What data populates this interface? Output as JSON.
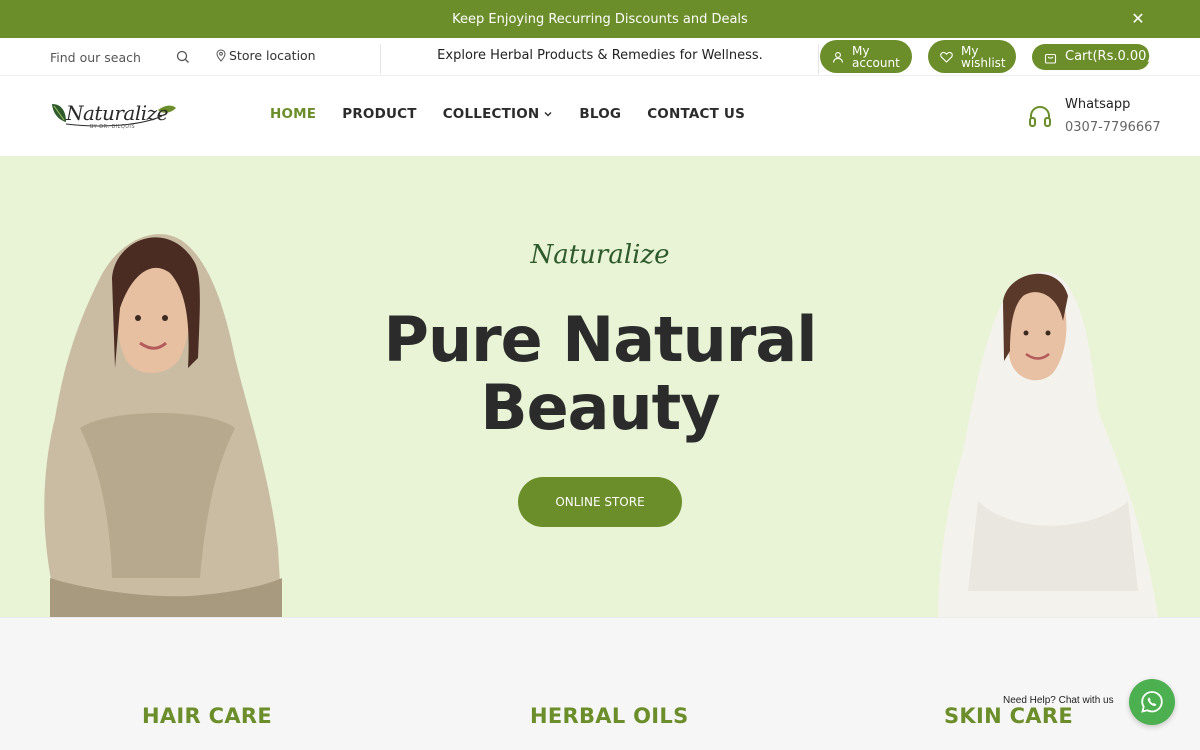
{
  "announcement": {
    "text": "Keep Enjoying Recurring Discounts and Deals",
    "close_icon": "close-icon"
  },
  "utility": {
    "search_placeholder": "Find our seach",
    "store_location": "Store location",
    "tagline": "Explore Herbal Products & Remedies for Wellness.",
    "account_label": "My account",
    "wishlist_label": "My wishlist",
    "cart_label": "Cart(Rs.0.00)"
  },
  "logo": {
    "wordmark": "Naturalize",
    "byline": "BY DR. BILQUIS"
  },
  "nav": {
    "home": "HOME",
    "product": "PRODUCT",
    "collection": "COLLECTION",
    "blog": "BLOG",
    "contact": "CONTACT US"
  },
  "contact": {
    "title": "Whatsapp",
    "phone": "0307-7796667"
  },
  "hero": {
    "script": "Naturalize",
    "headline_line1": "Pure Natural",
    "headline_line2": "Beauty",
    "cta": "ONLINE STORE"
  },
  "categories": [
    "HAIR CARE",
    "HERBAL OILS",
    "SKIN CARE"
  ],
  "whatsapp_widget": {
    "help_text": "Need Help? Chat with us"
  },
  "colors": {
    "brand_green": "#6b8e2a",
    "hero_bg": "#e9f4d6",
    "whatsapp": "#4caf50"
  }
}
